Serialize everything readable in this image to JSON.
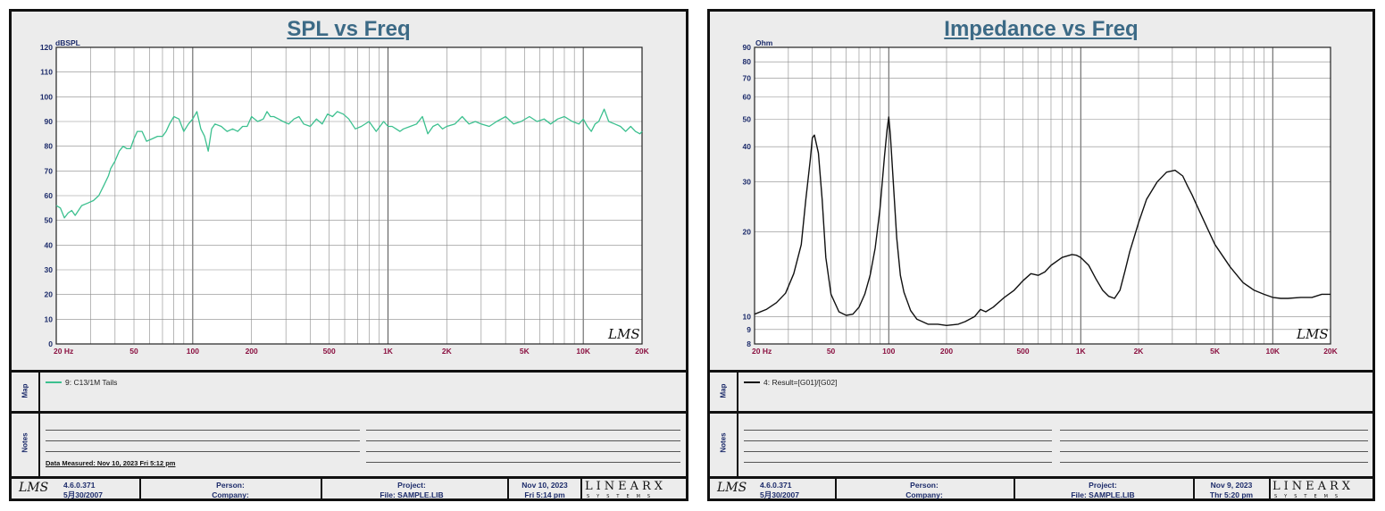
{
  "chart_data": [
    {
      "type": "line",
      "title": "SPL vs Freq",
      "ylabel": "dBSPL",
      "xscale": "log",
      "yscale": "linear",
      "xlim": [
        20,
        20000
      ],
      "ylim": [
        0,
        120
      ],
      "grid": true,
      "yticks": [
        0,
        10,
        20,
        30,
        40,
        50,
        60,
        70,
        80,
        90,
        100,
        110,
        120
      ],
      "xtick_labels": [
        {
          "v": 20,
          "t": "20  Hz"
        },
        {
          "v": 50,
          "t": "50"
        },
        {
          "v": 100,
          "t": "100"
        },
        {
          "v": 200,
          "t": "200"
        },
        {
          "v": 500,
          "t": "500"
        },
        {
          "v": 1000,
          "t": "1K"
        },
        {
          "v": 2000,
          "t": "2K"
        },
        {
          "v": 5000,
          "t": "5K"
        },
        {
          "v": 10000,
          "t": "10K"
        },
        {
          "v": 20000,
          "t": "20K"
        }
      ],
      "series": [
        {
          "name": "9: C13/1M Tails",
          "color": "#3cc08f",
          "x": [
            20,
            21,
            22,
            23,
            24,
            25,
            27,
            29,
            31,
            33,
            35,
            37,
            38,
            40,
            42,
            44,
            46,
            48,
            50,
            52,
            55,
            58,
            62,
            66,
            70,
            73,
            76,
            80,
            85,
            90,
            95,
            100,
            105,
            110,
            115,
            120,
            125,
            130,
            140,
            150,
            160,
            170,
            180,
            190,
            200,
            215,
            230,
            240,
            250,
            260,
            275,
            290,
            310,
            330,
            350,
            370,
            400,
            430,
            460,
            490,
            520,
            550,
            590,
            630,
            680,
            730,
            800,
            870,
            950,
            1000,
            1050,
            1100,
            1150,
            1200,
            1300,
            1400,
            1500,
            1600,
            1700,
            1800,
            1900,
            2000,
            2200,
            2400,
            2600,
            2800,
            3000,
            3300,
            3600,
            4000,
            4400,
            4800,
            5300,
            5800,
            6300,
            6800,
            7400,
            8000,
            8800,
            9500,
            10000,
            10500,
            11000,
            11500,
            12000,
            12800,
            13500,
            14500,
            15500,
            16500,
            17500,
            18500,
            19500,
            20000
          ],
          "y": [
            56,
            55,
            51,
            53,
            54,
            52,
            56,
            57,
            58,
            60,
            64,
            68,
            71,
            74,
            78,
            80,
            79,
            79,
            83,
            86,
            86,
            82,
            83,
            84,
            84,
            86,
            89,
            92,
            91,
            86,
            89,
            91,
            94,
            87,
            84,
            78,
            87,
            89,
            88,
            86,
            87,
            86,
            88,
            88,
            92,
            90,
            91,
            94,
            92,
            92,
            91,
            90,
            89,
            91,
            92,
            89,
            88,
            91,
            89,
            93,
            92,
            94,
            93,
            91,
            87,
            88,
            90,
            86,
            90,
            88,
            88,
            87,
            86,
            87,
            88,
            89,
            92,
            85,
            88,
            89,
            87,
            88,
            89,
            92,
            89,
            90,
            89,
            88,
            90,
            92,
            89,
            90,
            92,
            90,
            91,
            89,
            91,
            92,
            90,
            89,
            91,
            88,
            86,
            89,
            90,
            95,
            90,
            89,
            88,
            86,
            88,
            86,
            85,
            86
          ]
        }
      ]
    },
    {
      "type": "line",
      "title": "Impedance vs Freq",
      "ylabel": "Ohm",
      "xscale": "log",
      "yscale": "log",
      "xlim": [
        20,
        20000
      ],
      "ylim": [
        8,
        90
      ],
      "grid": true,
      "yticks": [
        8,
        9,
        10,
        20,
        30,
        40,
        50,
        60,
        70,
        80,
        90
      ],
      "xtick_labels": [
        {
          "v": 20,
          "t": "20  Hz"
        },
        {
          "v": 50,
          "t": "50"
        },
        {
          "v": 100,
          "t": "100"
        },
        {
          "v": 200,
          "t": "200"
        },
        {
          "v": 500,
          "t": "500"
        },
        {
          "v": 1000,
          "t": "1K"
        },
        {
          "v": 2000,
          "t": "2K"
        },
        {
          "v": 5000,
          "t": "5K"
        },
        {
          "v": 10000,
          "t": "10K"
        },
        {
          "v": 20000,
          "t": "20K"
        }
      ],
      "series": [
        {
          "name": "4: Result=[G01]/[G02]",
          "color": "#111111",
          "x": [
            20,
            23,
            26,
            29,
            32,
            35,
            37,
            39,
            40,
            41,
            43,
            45,
            47,
            50,
            55,
            60,
            65,
            70,
            75,
            80,
            85,
            90,
            95,
            98,
            100,
            102,
            105,
            110,
            115,
            120,
            130,
            140,
            160,
            180,
            200,
            230,
            250,
            280,
            300,
            320,
            350,
            400,
            450,
            500,
            550,
            600,
            650,
            700,
            800,
            900,
            950,
            1000,
            1100,
            1200,
            1300,
            1400,
            1500,
            1600,
            1700,
            1800,
            2000,
            2200,
            2500,
            2800,
            3100,
            3400,
            3600,
            3800,
            4000,
            4500,
            5000,
            6000,
            7000,
            8000,
            9000,
            10000,
            11000,
            12000,
            14000,
            16000,
            18000,
            20000
          ],
          "y": [
            10.2,
            10.6,
            11.2,
            12.1,
            14.2,
            18,
            26,
            36,
            43,
            44,
            38,
            26,
            16.2,
            12,
            10.4,
            10.1,
            10.2,
            10.8,
            12,
            14,
            17.5,
            24,
            37,
            46,
            51,
            44,
            32,
            19,
            14,
            12.2,
            10.5,
            9.8,
            9.4,
            9.4,
            9.3,
            9.4,
            9.6,
            10,
            10.6,
            10.4,
            10.8,
            11.7,
            12.4,
            13.4,
            14.2,
            14,
            14.4,
            15.2,
            16.2,
            16.6,
            16.5,
            16.2,
            15.2,
            13.6,
            12.4,
            11.8,
            11.6,
            12.4,
            14.5,
            17,
            21.5,
            26,
            30,
            32.5,
            33,
            31.5,
            29,
            27,
            25,
            21,
            18,
            15,
            13.2,
            12.4,
            12,
            11.7,
            11.6,
            11.6,
            11.7,
            11.7,
            12,
            12
          ]
        }
      ]
    }
  ],
  "left": {
    "map_label": "Map",
    "notes_label": "Notes",
    "data_measured": "Data Measured: Nov 10, 2023  Fri  5:12 pm",
    "footer": {
      "lms": "LMS",
      "version": "4.6.0.371",
      "build": "5月30/2007",
      "person": "Person:",
      "company": "Company:",
      "project": "Project:",
      "file": "File: SAMPLE.LIB",
      "date": "Nov 10, 2023",
      "time": "Fri  5:14 pm",
      "logo": "LINEARX",
      "logo_sub": "SYSTEMS"
    }
  },
  "right": {
    "map_label": "Map",
    "notes_label": "Notes",
    "footer": {
      "lms": "LMS",
      "version": "4.6.0.371",
      "build": "5月30/2007",
      "person": "Person:",
      "company": "Company:",
      "project": "Project:",
      "file": "File: SAMPLE.LIB",
      "date": "Nov  9, 2023",
      "time": "Thr  5:20 pm",
      "logo": "LINEARX",
      "logo_sub": "SYSTEMS"
    }
  },
  "watermark": "LMS"
}
